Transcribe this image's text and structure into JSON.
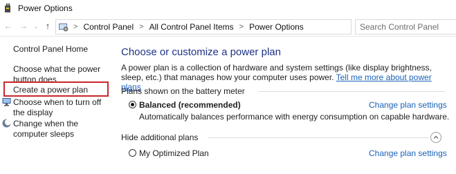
{
  "window": {
    "title": "Power Options",
    "icons": {
      "app": "power-options-icon"
    }
  },
  "nav": {
    "back_icon": "back-arrow-icon",
    "forward_icon": "forward-arrow-icon",
    "recent_icon": "chevron-down-icon",
    "up_icon": "up-arrow-icon"
  },
  "address": {
    "icon": "control-panel-icon",
    "crumbs": [
      "Control Panel",
      "All Control Panel Items",
      "Power Options"
    ],
    "separator": ">"
  },
  "search": {
    "placeholder": "Search Control Panel"
  },
  "sidebar": {
    "home": "Control Panel Home",
    "items": [
      {
        "label": "Choose what the power button does"
      },
      {
        "label": "Create a power plan",
        "highlighted": true
      },
      {
        "label": "Choose when to turn off the display",
        "icon": "display-icon"
      },
      {
        "label": "Change when the computer sleeps",
        "icon": "moon-icon"
      }
    ]
  },
  "main": {
    "heading": "Choose or customize a power plan",
    "description": "A power plan is a collection of hardware and system settings (like display brightness, sleep, etc.) that manages how your computer uses power.",
    "description_link": "Tell me more about power plans",
    "battery_section": "Plans shown on the battery meter",
    "plans": [
      {
        "name": "Balanced (recommended)",
        "selected": true,
        "description": "Automatically balances performance with energy consumption on capable hardware.",
        "change_link": "Change plan settings"
      }
    ],
    "hidden_section": "Hide additional plans",
    "hidden_plans": [
      {
        "name": "My Optimized Plan",
        "selected": false,
        "change_link": "Change plan settings"
      }
    ]
  },
  "colors": {
    "heading": "#1e3287",
    "link": "#1a62b8",
    "highlight": "#c8262a"
  }
}
